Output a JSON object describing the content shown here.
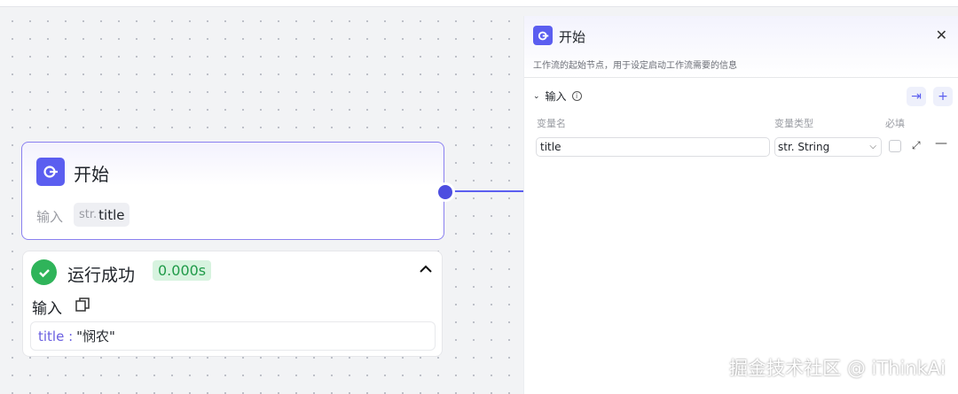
{
  "node": {
    "title": "开始",
    "input_label": "输入",
    "param_type": "str.",
    "param_name": "title"
  },
  "run": {
    "status": "运行成功",
    "time": "0.000s",
    "input_label": "输入",
    "key": "title :",
    "value": "\"悯农\""
  },
  "panel": {
    "title": "开始",
    "description": "工作流的起始节点，用于设定启动工作流需要的信息",
    "section": "输入",
    "info": "i",
    "import": "⇥",
    "add": "+",
    "headers": {
      "name": "变量名",
      "type": "变量类型",
      "required": "必填"
    },
    "rows": [
      {
        "name": "title",
        "type": "str. String"
      }
    ]
  },
  "watermark": "掘金技术社区 @ iThinkAi",
  "colors": {
    "accent": "#5b5ef0",
    "success": "#2fb45a"
  }
}
